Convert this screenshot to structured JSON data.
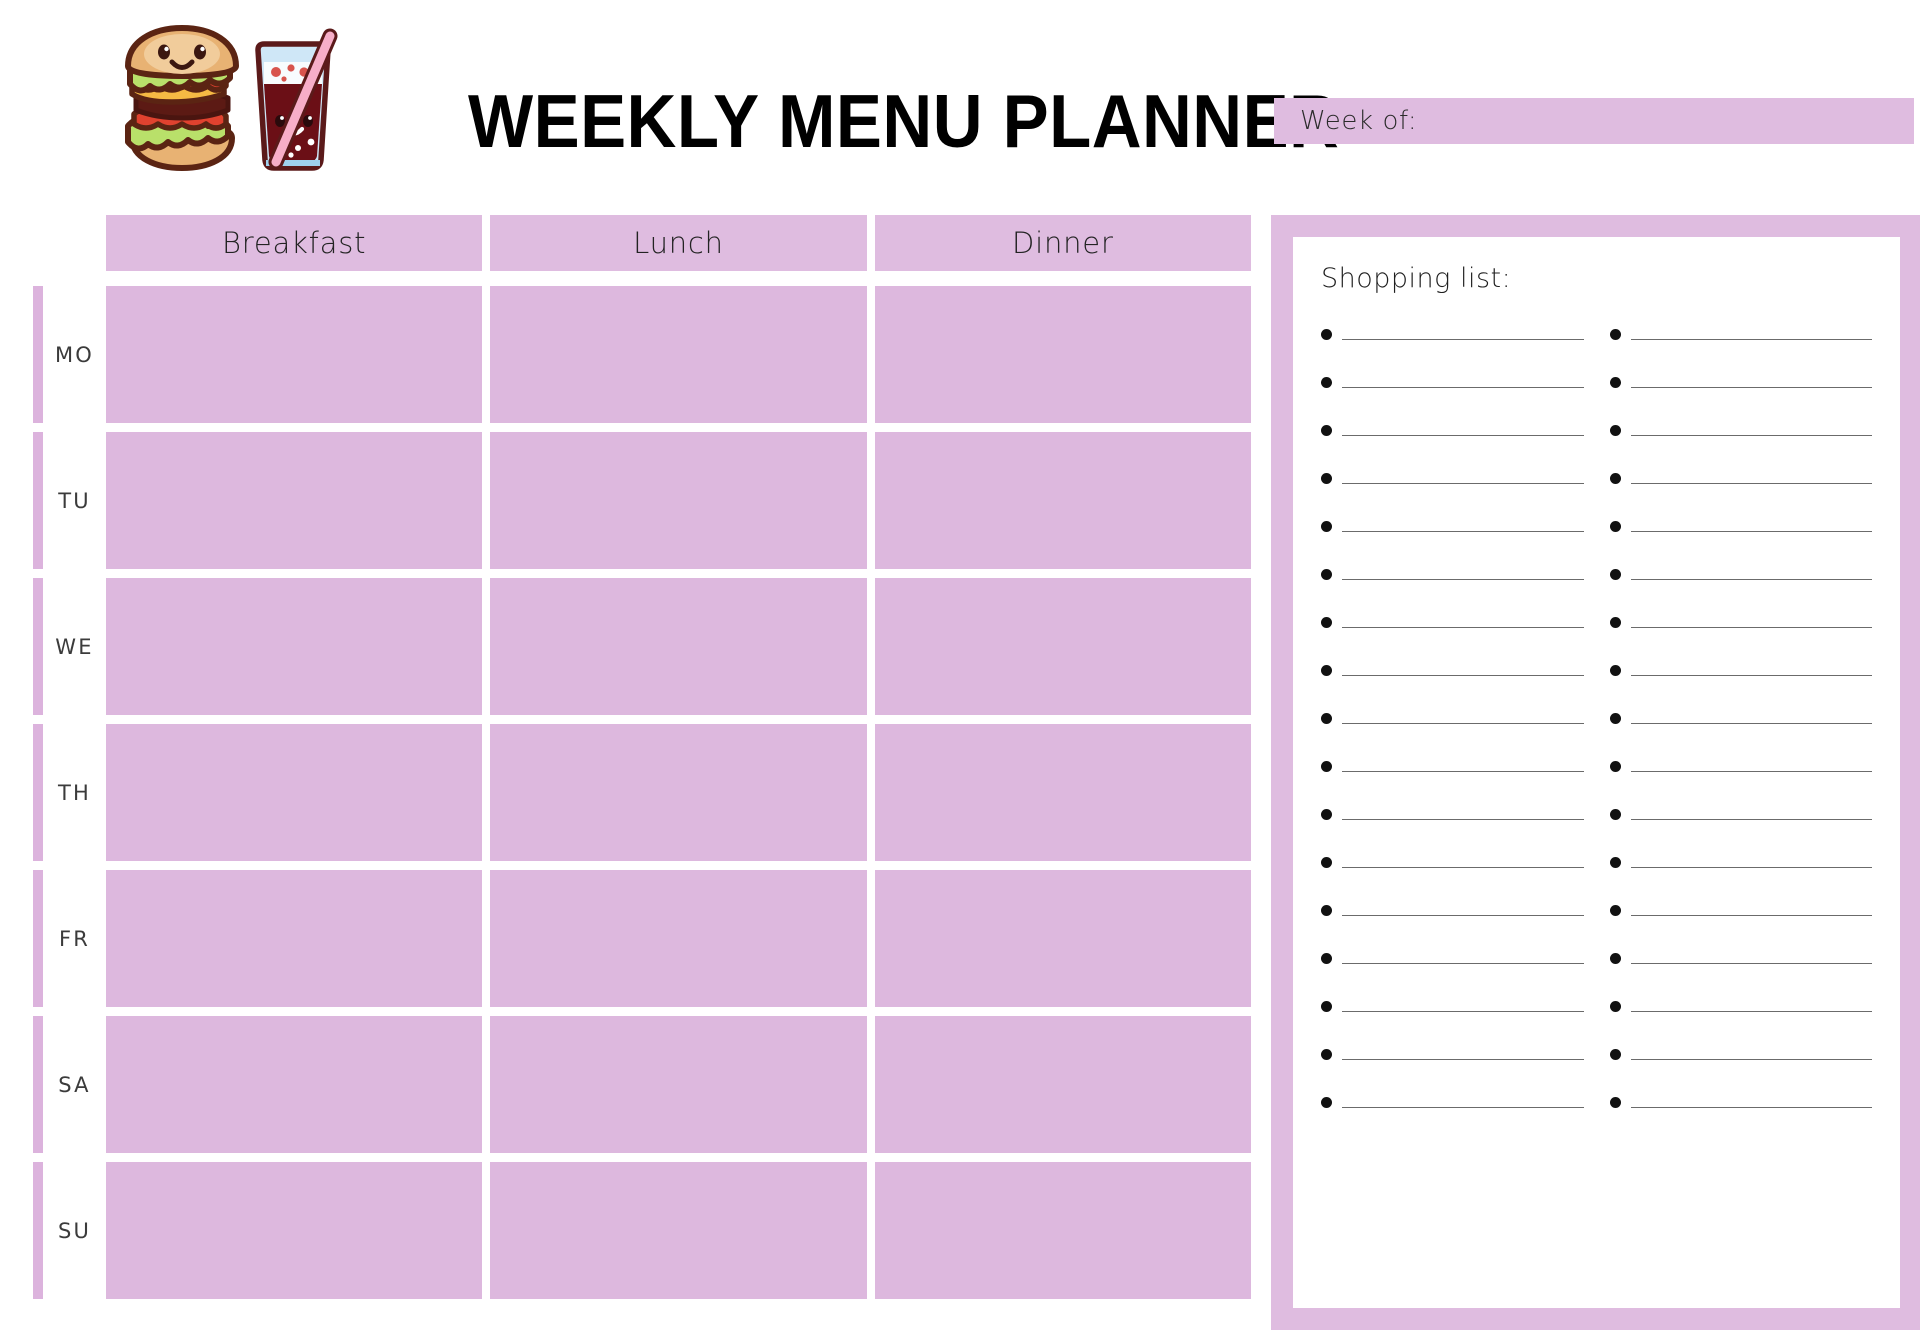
{
  "header": {
    "title": "WEEKLY MENU PLANNER",
    "week_of_label": "Week of:",
    "mascot_icons": [
      "burger-icon",
      "soda-cup-icon"
    ]
  },
  "menu": {
    "columns": [
      "Breakfast",
      "Lunch",
      "Dinner"
    ],
    "days": [
      "MO",
      "TU",
      "WE",
      "TH",
      "FR",
      "SA",
      "SU"
    ],
    "cell_values": [
      [
        "",
        "",
        ""
      ],
      [
        "",
        "",
        ""
      ],
      [
        "",
        "",
        ""
      ],
      [
        "",
        "",
        ""
      ],
      [
        "",
        "",
        ""
      ],
      [
        "",
        "",
        ""
      ],
      [
        "",
        "",
        ""
      ]
    ]
  },
  "shopping": {
    "title": "Shopping list:",
    "rows_per_column": 17,
    "columns": [
      [
        "",
        "",
        "",
        "",
        "",
        "",
        "",
        "",
        "",
        "",
        "",
        "",
        "",
        "",
        "",
        "",
        ""
      ],
      [
        "",
        "",
        "",
        "",
        "",
        "",
        "",
        "",
        "",
        "",
        "",
        "",
        "",
        "",
        "",
        "",
        ""
      ]
    ]
  },
  "colors": {
    "cell_fill": "#ddb8de",
    "header_fill": "#dfbce0",
    "accent_bar": "#dcb3dd",
    "panel_frame": "#dfbce0",
    "page_background": "#ffffff",
    "text_dark": "#232323",
    "rule_line": "#6b6b6b"
  }
}
